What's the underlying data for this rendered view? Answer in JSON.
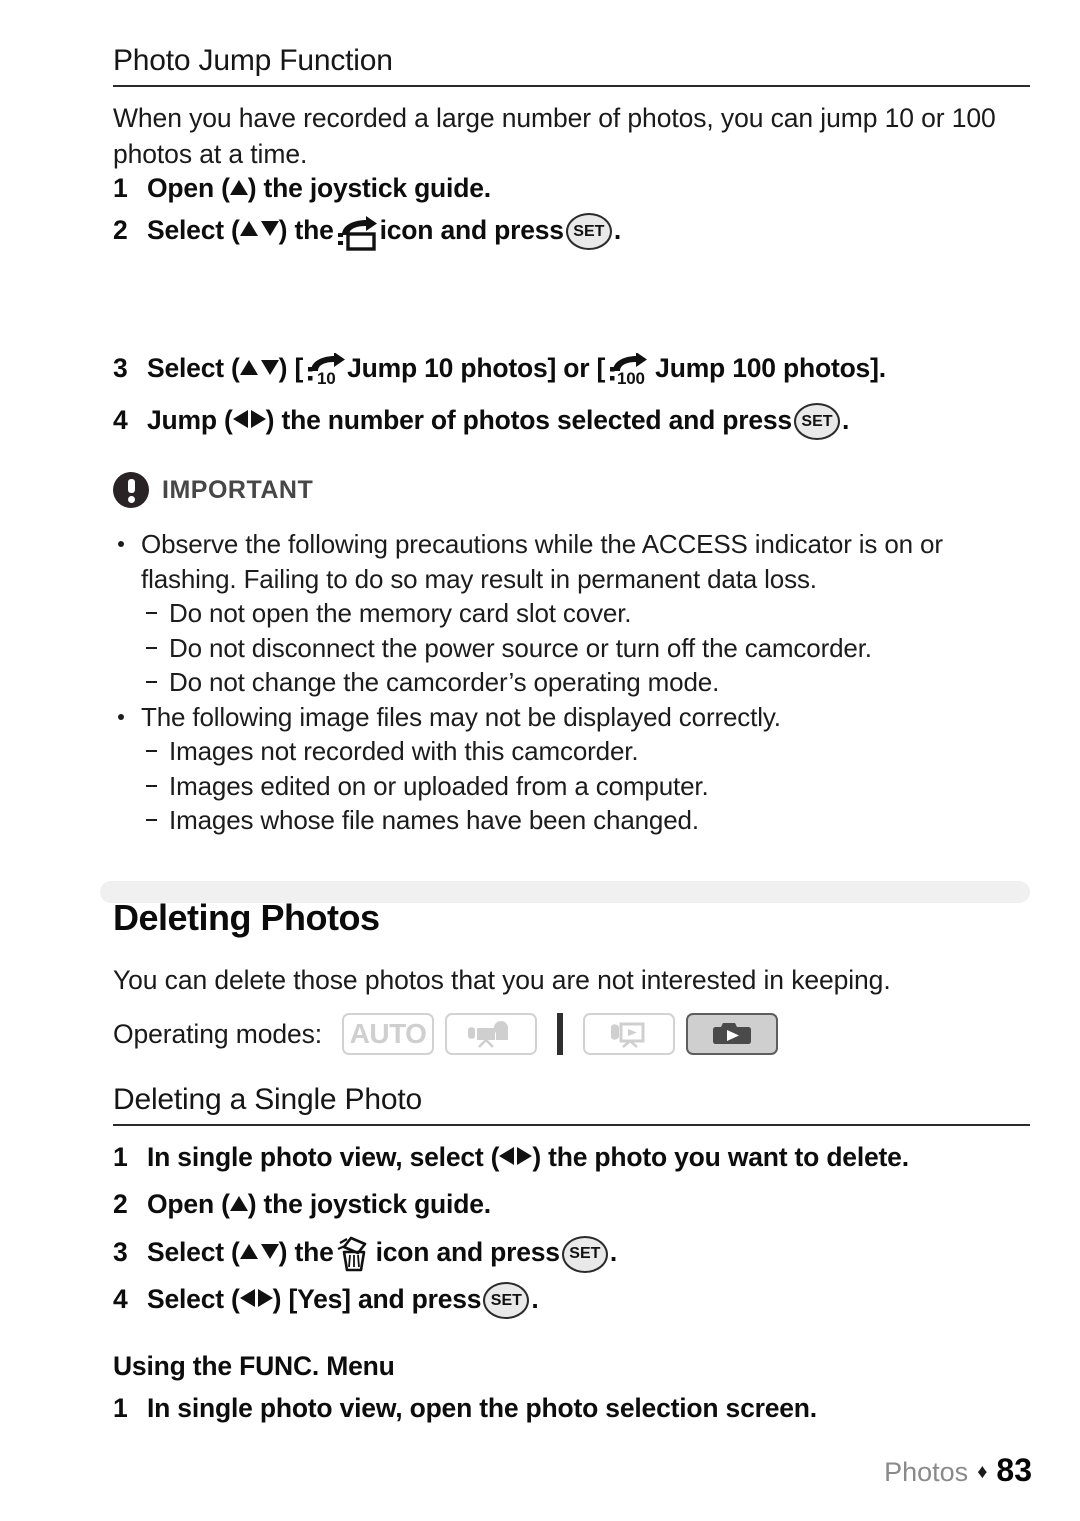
{
  "page": {
    "subheading_1": "Photo Jump Function",
    "intro_paragraph": "When you have recorded a large number of photos, you can jump 10 or 100 photos at a time."
  },
  "jump_steps": [
    {
      "num": "1",
      "before": "Open (",
      "after": ") the joystick guide.",
      "arrows": "up",
      "icon": null,
      "tail": null,
      "set": false
    },
    {
      "num": "2",
      "before": "Select (",
      "after": ") the ",
      "arrows": "updown",
      "icon": "jump-photo-icon",
      "tail": " icon and press ",
      "set": true,
      "end": "."
    },
    {
      "num": "3",
      "before": "Select (",
      "after": ") [",
      "arrows": "updown",
      "icon": "jump-10-icon",
      "tail": " Jump 10 photos] or [",
      "icon2": "jump-100-icon",
      "tail2": " Jump 100 photos].",
      "set": false
    },
    {
      "num": "4",
      "before": "Jump (",
      "after": ") the number of photos selected and press ",
      "arrows": "leftright",
      "icon": null,
      "set": true,
      "end": "."
    }
  ],
  "important": {
    "label": "IMPORTANT",
    "icon": "exclamation-circle-icon",
    "items": [
      {
        "text": "Observe the following precautions while the ACCESS indicator is on or flashing. Failing to do so may result in permanent data loss.",
        "subitems": [
          "Do not open the memory card slot cover.",
          "Do not disconnect the power source or turn off the camcorder.",
          "Do not change the camcorder’s operating mode."
        ]
      },
      {
        "text": "The following image files may not be displayed correctly.",
        "subitems": [
          "Images not recorded with this camcorder.",
          "Images edited on or uploaded from a computer.",
          "Images whose file names have been changed."
        ]
      }
    ]
  },
  "deleting": {
    "section_title": "Deleting Photos",
    "description": "You can delete those photos that you are not interested in keeping.",
    "operating_modes_label": "Operating modes:",
    "modes": [
      {
        "name": "auto-mode-badge",
        "label": "AUTO",
        "icon": null,
        "active": false
      },
      {
        "name": "movie-record-mode-badge",
        "label": "",
        "icon": "camcorder-icon",
        "active": false
      },
      {
        "name": "movie-playback-mode-badge",
        "label": "",
        "icon": "movie-playback-icon",
        "active": false
      },
      {
        "name": "photo-playback-mode-badge",
        "label": "",
        "icon": "photo-playback-icon",
        "active": true
      }
    ],
    "subheading": "Deleting a Single Photo",
    "steps": [
      {
        "num": "1",
        "before": "In single photo view, select (",
        "after": ") the photo you want to delete.",
        "arrows": "leftright",
        "icon": null,
        "set": false
      },
      {
        "num": "2",
        "before": "Open (",
        "after": ") the joystick guide.",
        "arrows": "up",
        "icon": null,
        "set": false
      },
      {
        "num": "3",
        "before": "Select (",
        "after": ") the ",
        "arrows": "updown",
        "icon": "trash-can-icon",
        "tail": " icon and press ",
        "set": true,
        "end": "."
      },
      {
        "num": "4",
        "before": "Select (",
        "after": ") [Yes] and press ",
        "arrows": "leftright",
        "icon": null,
        "set": true,
        "end": "."
      }
    ],
    "func_menu_heading": "Using the FUNC. Menu",
    "func_menu_step": {
      "num": "1",
      "text": "In single photo view, open the photo selection screen."
    }
  },
  "footer": {
    "chapter": "Photos",
    "separator": "♦",
    "page_number": "83"
  },
  "set_button_label": "SET"
}
